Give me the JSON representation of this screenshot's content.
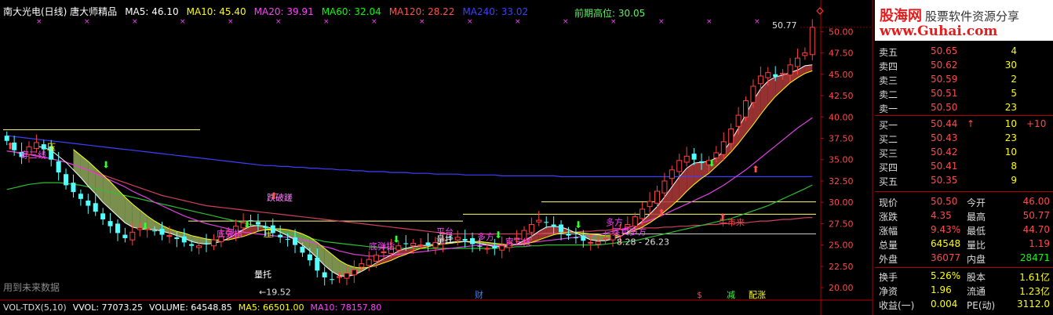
{
  "header": {
    "title": "南大光电(日线) 唐大师精品",
    "ma": [
      {
        "label": "MA5: 46.10",
        "color": "#ffffff"
      },
      {
        "label": "MA10: 45.40",
        "color": "#ffff00"
      },
      {
        "label": "MA20: 39.91",
        "color": "#ff40ff"
      },
      {
        "label": "MA60: 32.04",
        "color": "#00ff00"
      },
      {
        "label": "MA120: 28.22",
        "color": "#ff5050"
      },
      {
        "label": "MA240: 33.02",
        "color": "#3f3fff"
      }
    ],
    "prev_high": "前期高位: 30.05"
  },
  "chart_data": {
    "type": "candlestick",
    "y_axis_ticks": [
      "50.00",
      "47.50",
      "45.00",
      "42.50",
      "40.00",
      "37.50",
      "35.00",
      "32.50",
      "30.00",
      "27.50",
      "25.00",
      "22.50",
      "20.00"
    ],
    "ylim": [
      19.0,
      51.5
    ],
    "price_high_label": "50.77",
    "price_low_label": "←19.52",
    "range_label": "8.28 - 26.23",
    "annotations": [
      "穿三线",
      "压",
      "跌破蹉",
      "底弹指",
      "压",
      "量托",
      "底弹指",
      "量托",
      "平台",
      "多方",
      "穿三线",
      "多方",
      "买卖多方",
      "牛市来"
    ],
    "bottom_markers": [
      "财",
      "$",
      "减",
      "配涨"
    ],
    "footnote": "用到未来数据",
    "close": [
      37.2,
      36.1,
      35.3,
      36.5,
      37.0,
      36.2,
      35.0,
      33.5,
      32.0,
      31.2,
      30.4,
      29.6,
      28.9,
      28.0,
      27.2,
      26.4,
      25.8,
      26.5,
      27.0,
      26.9,
      26.6,
      26.2,
      26.1,
      25.7,
      25.3,
      24.9,
      24.9,
      25.1,
      25.6,
      26.0,
      26.6,
      27.2,
      27.6,
      27.9,
      27.4,
      27.0,
      26.4,
      25.9,
      25.6,
      25.0,
      24.1,
      23.2,
      22.0,
      21.2,
      20.9,
      21.3,
      21.7,
      22.1,
      22.8,
      23.3,
      23.8,
      24.2,
      24.6,
      24.9,
      25.1,
      25.2,
      25.0,
      24.9,
      25.3,
      25.6,
      25.8,
      25.9,
      25.5,
      25.1,
      24.8,
      24.6,
      24.6,
      24.9,
      25.3,
      25.8,
      26.7,
      27.4,
      27.9,
      27.6,
      27.1,
      26.5,
      26.1,
      25.8,
      25.5,
      25.3,
      25.4,
      25.8,
      26.3,
      26.8,
      27.4,
      28.3,
      29.2,
      30.1,
      31.3,
      32.5,
      33.8,
      34.9,
      35.4,
      35.0,
      34.6,
      34.9,
      35.8,
      37.1,
      38.6,
      40.2,
      41.9,
      43.6,
      44.8,
      45.2,
      44.7,
      45.1,
      46.1,
      46.9,
      47.5,
      50.5
    ],
    "ma5": [
      null,
      null,
      null,
      null,
      36.6,
      36.4,
      36.1,
      35.4,
      34.7,
      33.8,
      32.9,
      31.9,
      31.0,
      30.0,
      29.2,
      28.4,
      27.6,
      27.1,
      26.9,
      26.8,
      26.8,
      26.6,
      26.4,
      26.1,
      25.8,
      25.4,
      25.2,
      25.1,
      25.2,
      25.4,
      25.8,
      26.3,
      26.8,
      27.2,
      27.3,
      27.2,
      26.9,
      26.5,
      26.1,
      25.6,
      25.0,
      24.3,
      23.5,
      22.6,
      21.9,
      21.4,
      21.3,
      21.5,
      21.9,
      22.4,
      22.9,
      23.4,
      23.8,
      24.3,
      24.6,
      24.8,
      24.9,
      25.0,
      25.1,
      25.2,
      25.3,
      25.4,
      25.4,
      25.3,
      25.2,
      25.0,
      24.8,
      24.8,
      24.9,
      25.1,
      25.5,
      26.0,
      26.6,
      27.1,
      27.2,
      27.1,
      26.8,
      26.4,
      26.0,
      25.6,
      25.5,
      25.5,
      25.7,
      26.0,
      26.5,
      27.1,
      27.8,
      28.6,
      29.5,
      30.6,
      31.8,
      33.0,
      34.0,
      34.6,
      34.7,
      34.8,
      35.2,
      36.0,
      37.2,
      38.7,
      40.3,
      41.9,
      43.3,
      44.2,
      44.7,
      44.9,
      45.2,
      45.5,
      46.0,
      46.1
    ],
    "ma10": [
      null,
      null,
      null,
      null,
      null,
      null,
      null,
      null,
      null,
      36.2,
      35.5,
      34.8,
      34.0,
      33.2,
      32.4,
      31.5,
      30.6,
      29.8,
      29.1,
      28.4,
      27.8,
      27.3,
      26.9,
      26.6,
      26.4,
      26.1,
      25.9,
      25.7,
      25.6,
      25.6,
      25.6,
      25.8,
      26.0,
      26.3,
      26.6,
      26.8,
      26.9,
      26.9,
      26.8,
      26.6,
      26.3,
      25.9,
      25.3,
      24.6,
      23.9,
      23.2,
      22.7,
      22.4,
      22.3,
      22.4,
      22.6,
      22.9,
      23.2,
      23.6,
      23.9,
      24.3,
      24.6,
      24.8,
      25.0,
      25.1,
      25.2,
      25.3,
      25.4,
      25.4,
      25.4,
      25.3,
      25.2,
      25.1,
      25.0,
      25.0,
      25.1,
      25.3,
      25.6,
      25.9,
      26.2,
      26.4,
      26.5,
      26.5,
      26.4,
      26.3,
      26.2,
      26.1,
      26.1,
      26.2,
      26.4,
      26.7,
      27.1,
      27.6,
      28.2,
      28.9,
      29.6,
      30.4,
      31.3,
      32.1,
      32.8,
      33.4,
      34.2,
      35.0,
      35.9,
      36.9,
      38.0,
      39.1,
      40.3,
      41.4,
      42.4,
      43.2,
      44.0,
      44.6,
      45.1,
      45.4
    ],
    "ma20": [
      36.0,
      35.9,
      35.7,
      35.6,
      35.4,
      35.3,
      35.1,
      34.9,
      34.7,
      34.4,
      34.1,
      33.8,
      33.4,
      33.0,
      32.6,
      32.2,
      31.8,
      31.3,
      30.9,
      30.5,
      30.0,
      29.6,
      29.2,
      28.8,
      28.4,
      28.1,
      27.8,
      27.5,
      27.3,
      27.1,
      26.9,
      26.7,
      26.5,
      26.4,
      26.3,
      26.2,
      26.1,
      26.0,
      25.9,
      25.8,
      25.6,
      25.4,
      25.1,
      24.8,
      24.6,
      24.3,
      24.1,
      23.9,
      23.8,
      23.7,
      23.7,
      23.7,
      23.8,
      23.9,
      24.0,
      24.1,
      24.2,
      24.3,
      24.4,
      24.5,
      24.6,
      24.7,
      24.8,
      24.9,
      25.0,
      25.0,
      25.0,
      25.0,
      25.0,
      25.1,
      25.2,
      25.3,
      25.4,
      25.5,
      25.6,
      25.7,
      25.8,
      25.9,
      26.0,
      26.1,
      26.2,
      26.4,
      26.6,
      26.8,
      27.0,
      27.3,
      27.6,
      27.9,
      28.2,
      28.6,
      29.0,
      29.4,
      29.8,
      30.2,
      30.6,
      31.0,
      31.5,
      32.0,
      32.6,
      33.2,
      33.8,
      34.5,
      35.2,
      35.9,
      36.6,
      37.3,
      38.0,
      38.7,
      39.3,
      39.91
    ],
    "ma60": [
      31.5,
      31.7,
      31.9,
      32.1,
      32.2,
      32.3,
      32.3,
      32.3,
      32.2,
      32.1,
      32.0,
      31.8,
      31.6,
      31.4,
      31.2,
      31.0,
      30.8,
      30.6,
      30.4,
      30.2,
      30.0,
      29.8,
      29.6,
      29.4,
      29.2,
      29.0,
      28.8,
      28.6,
      28.4,
      28.2,
      28.0,
      27.8,
      27.6,
      27.4,
      27.2,
      27.0,
      26.8,
      26.6,
      26.4,
      26.2,
      26.0,
      25.8,
      25.6,
      25.4,
      25.3,
      25.2,
      25.1,
      25.0,
      24.9,
      24.8,
      24.7,
      24.7,
      24.6,
      24.6,
      24.6,
      24.6,
      24.6,
      24.6,
      24.6,
      24.6,
      24.6,
      24.6,
      24.6,
      24.6,
      24.6,
      24.6,
      24.6,
      24.7,
      24.7,
      24.8,
      24.8,
      24.9,
      24.9,
      25.0,
      25.0,
      25.0,
      25.0,
      25.0,
      25.0,
      25.0,
      25.0,
      25.1,
      25.2,
      25.3,
      25.4,
      25.5,
      25.7,
      25.9,
      26.1,
      26.3,
      26.5,
      26.7,
      26.9,
      27.1,
      27.3,
      27.5,
      27.7,
      27.9,
      28.1,
      28.4,
      28.7,
      29.0,
      29.3,
      29.6,
      30.0,
      30.4,
      30.8,
      31.2,
      31.6,
      32.04
    ],
    "ma120": [
      36.0,
      35.9,
      35.8,
      35.6,
      35.5,
      35.3,
      35.1,
      34.9,
      34.7,
      34.4,
      34.1,
      33.8,
      33.5,
      33.2,
      32.9,
      32.6,
      32.3,
      32.0,
      31.7,
      31.4,
      31.1,
      30.8,
      30.6,
      30.4,
      30.2,
      30.0,
      29.8,
      29.6,
      29.5,
      29.4,
      29.3,
      29.2,
      29.1,
      29.0,
      28.9,
      28.8,
      28.7,
      28.6,
      28.5,
      28.4,
      28.3,
      28.2,
      28.1,
      28.0,
      27.9,
      27.8,
      27.7,
      27.6,
      27.5,
      27.4,
      27.3,
      27.2,
      27.1,
      27.0,
      26.9,
      26.8,
      26.7,
      26.6,
      26.5,
      26.4,
      26.3,
      26.3,
      26.3,
      26.3,
      26.3,
      26.3,
      26.3,
      26.3,
      26.3,
      26.3,
      26.3,
      26.3,
      26.3,
      26.4,
      26.4,
      26.4,
      26.5,
      26.5,
      26.6,
      26.6,
      26.7,
      26.7,
      26.8,
      26.8,
      26.9,
      26.9,
      27.0,
      27.0,
      27.0,
      27.1,
      27.1,
      27.2,
      27.2,
      27.3,
      27.3,
      27.4,
      27.4,
      27.5,
      27.5,
      27.6,
      27.6,
      27.7,
      27.8,
      27.8,
      27.9,
      28.0,
      28.0,
      28.1,
      28.2,
      28.22
    ],
    "ma240": [
      37.8,
      37.7,
      37.6,
      37.5,
      37.4,
      37.3,
      37.2,
      37.1,
      37.0,
      36.9,
      36.8,
      36.7,
      36.6,
      36.5,
      36.4,
      36.3,
      36.2,
      36.1,
      36.0,
      35.9,
      35.8,
      35.7,
      35.6,
      35.5,
      35.4,
      35.3,
      35.2,
      35.1,
      35.0,
      34.9,
      34.8,
      34.7,
      34.6,
      34.5,
      34.4,
      34.3,
      34.3,
      34.2,
      34.2,
      34.1,
      34.1,
      34.0,
      34.0,
      33.9,
      33.9,
      33.8,
      33.8,
      33.7,
      33.7,
      33.6,
      33.6,
      33.6,
      33.5,
      33.5,
      33.5,
      33.4,
      33.4,
      33.4,
      33.3,
      33.3,
      33.3,
      33.3,
      33.2,
      33.2,
      33.2,
      33.2,
      33.2,
      33.1,
      33.1,
      33.1,
      33.1,
      33.1,
      33.1,
      33.1,
      33.1,
      33.0,
      33.0,
      33.0,
      33.0,
      33.0,
      33.0,
      33.0,
      33.0,
      33.0,
      33.0,
      33.0,
      33.0,
      33.0,
      33.0,
      33.0,
      33.0,
      33.0,
      33.0,
      33.0,
      33.0,
      33.0,
      33.0,
      33.0,
      33.0,
      33.0,
      33.0,
      33.0,
      33.0,
      33.0,
      33.0,
      33.0,
      33.0,
      33.0,
      33.0,
      33.02
    ]
  },
  "volume": {
    "indicator": "VOL-TDX(5,10)",
    "items": [
      {
        "label": "VVOL: 77073.25",
        "color": "#ffffff"
      },
      {
        "label": "VOLUME: 64548.85",
        "color": "#ffffff"
      },
      {
        "label": "MA5: 66501.00",
        "color": "#ffff00"
      },
      {
        "label": "MA10: 78157.80",
        "color": "#ff40ff"
      }
    ]
  },
  "logo": {
    "brand": "股海网",
    "slogan": "股票软件资源分享",
    "url": "www.Guhai.com"
  },
  "orderbook": {
    "sells": [
      {
        "label": "卖五",
        "price": "50.65",
        "vol": "4"
      },
      {
        "label": "卖四",
        "price": "50.62",
        "vol": "30"
      },
      {
        "label": "卖三",
        "price": "50.59",
        "vol": "2"
      },
      {
        "label": "卖二",
        "price": "50.51",
        "vol": "5"
      },
      {
        "label": "卖一",
        "price": "50.50",
        "vol": "23"
      }
    ],
    "buys": [
      {
        "label": "买一",
        "price": "50.44",
        "arrow": "↑",
        "vol": "10",
        "chg": "+10"
      },
      {
        "label": "买二",
        "price": "50.43",
        "arrow": "",
        "vol": "23",
        "chg": ""
      },
      {
        "label": "买三",
        "price": "50.42",
        "arrow": "",
        "vol": "10",
        "chg": ""
      },
      {
        "label": "买四",
        "price": "50.41",
        "arrow": "",
        "vol": "8",
        "chg": ""
      },
      {
        "label": "买五",
        "price": "50.35",
        "arrow": "",
        "vol": "9",
        "chg": ""
      }
    ]
  },
  "quote": [
    {
      "l1": "现价",
      "v1": "50.50",
      "c1": "#ff4a4a",
      "l2": "今开",
      "v2": "46.00",
      "c2": "#ff4a4a"
    },
    {
      "l1": "涨跌",
      "v1": "4.35",
      "c1": "#ff4a4a",
      "l2": "最高",
      "v2": "50.77",
      "c2": "#ff4a4a"
    },
    {
      "l1": "涨幅",
      "v1": "9.43%",
      "c1": "#ff4a4a",
      "l2": "最低",
      "v2": "44.70",
      "c2": "#ff4a4a"
    },
    {
      "l1": "总量",
      "v1": "64548",
      "c1": "#ffff00",
      "l2": "量比",
      "v2": "1.19",
      "c2": "#ff4a4a"
    },
    {
      "l1": "外盘",
      "v1": "36077",
      "c1": "#ff4a4a",
      "l2": "内盘",
      "v2": "28471",
      "c2": "#00ff00"
    },
    {
      "l1": "换手",
      "v1": "5.26%",
      "c1": "#ffff00",
      "l2": "股本",
      "v2": "1.61亿",
      "c2": "#ffff00"
    },
    {
      "l1": "净资",
      "v1": "1.96",
      "c1": "#ffff00",
      "l2": "流通",
      "v2": "1.23亿",
      "c2": "#ffff00"
    },
    {
      "l1": "收益(一)",
      "v1": "0.004",
      "c1": "#ffff00",
      "l2": "PE(动)",
      "v2": "3112.0",
      "c2": "#ffff00"
    }
  ]
}
